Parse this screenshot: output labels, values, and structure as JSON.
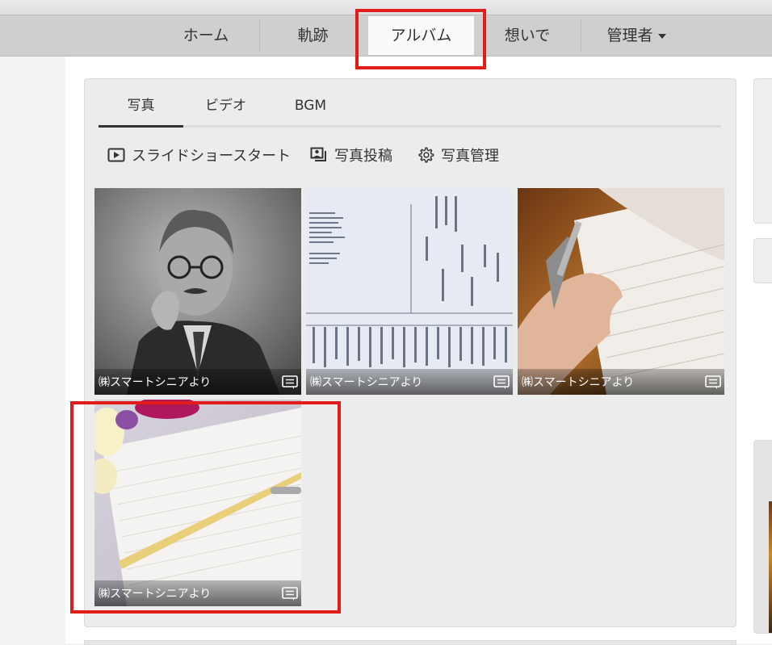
{
  "nav": {
    "items": [
      {
        "label": "ホーム"
      },
      {
        "label": "軌跡"
      },
      {
        "label": "アルバム"
      },
      {
        "label": "想いで"
      },
      {
        "label": "管理者"
      }
    ]
  },
  "tabs": [
    {
      "label": "写真"
    },
    {
      "label": "ビデオ"
    },
    {
      "label": "BGM"
    }
  ],
  "actions": {
    "slideshow": "スライドショースタート",
    "upload": "写真投稿",
    "manage": "写真管理"
  },
  "photos": [
    {
      "caption": "㈱スマートシニアより"
    },
    {
      "caption": "㈱スマートシニアより"
    },
    {
      "caption": "㈱スマートシニアより"
    },
    {
      "caption": "㈱スマートシニアより"
    }
  ],
  "icons": {
    "slideshow": "play-square-icon",
    "upload": "photo-upload-icon",
    "manage": "gear-icon",
    "comment": "comment-icon",
    "dropdown": "caret-down-icon"
  },
  "colors": {
    "highlight": "#e21b1b",
    "navbar": "#cfcfcf",
    "active_tab": "#fafafa"
  }
}
